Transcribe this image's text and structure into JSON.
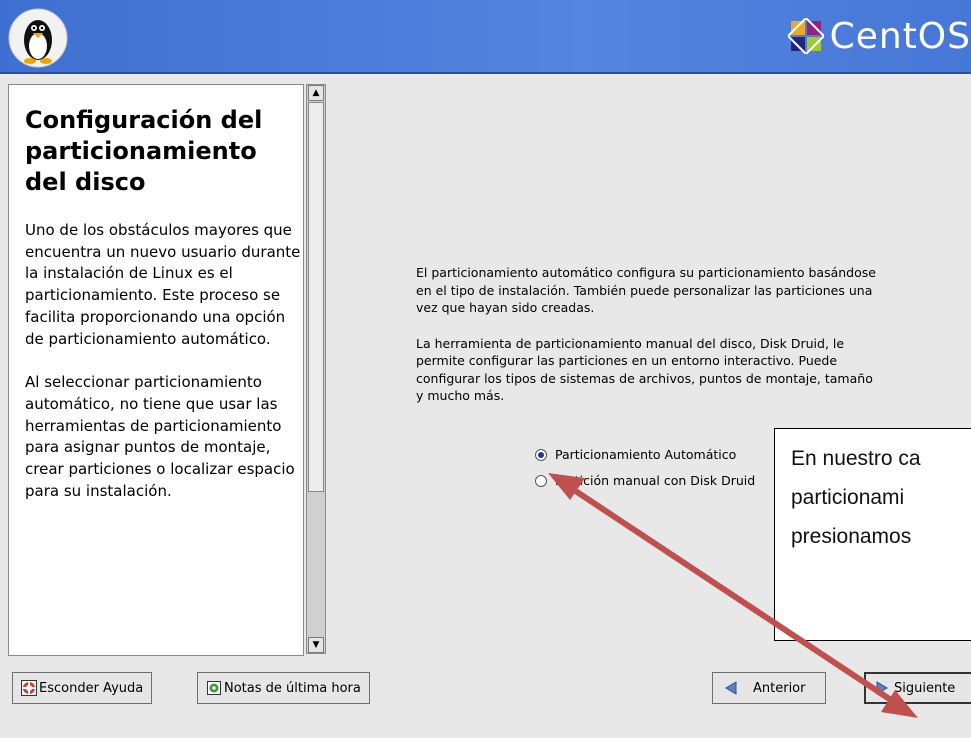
{
  "banner": {
    "logo_text": "CentOS",
    "colors": {
      "banner": "#4a7ad8",
      "logo_text": "#ffffff"
    }
  },
  "help": {
    "title": "Configuración del particionamiento del disco",
    "paragraph1": "Uno de los obstáculos mayores que encuentra un nuevo usuario durante la instalación de Linux es el particionamiento. Este proceso se facilita proporcionando una opción de particionamiento automático.",
    "paragraph2": "Al seleccionar particionamiento automático, no tiene que usar las herramientas de particionamiento para asignar puntos de montaje, crear particiones o localizar espacio para su instalación."
  },
  "main": {
    "paragraph1": "El particionamiento automático configura su particionamiento basándose en el tipo de instalación. También puede personalizar las particiones una vez que hayan sido creadas.",
    "paragraph2": "La herramienta de particionamiento manual del disco, Disk Druid, le permite configurar las particiones en un entorno interactivo. Puede configurar los tipos de sistemas de archivos, puntos de montaje, tamaño y mucho más.",
    "options": [
      {
        "label": "Particionamiento Automático",
        "selected": true
      },
      {
        "label": "Partición manual con Disk Druid",
        "selected": false
      }
    ]
  },
  "callout": {
    "lines": [
      "En nuestro ca",
      "particionami",
      "presionamos"
    ],
    "arrow_color": "#c0504d"
  },
  "buttons": {
    "hide_help": "Esconder Ayuda",
    "release_notes": "Notas de última hora",
    "back": "Anterior",
    "next": "Siguiente"
  }
}
